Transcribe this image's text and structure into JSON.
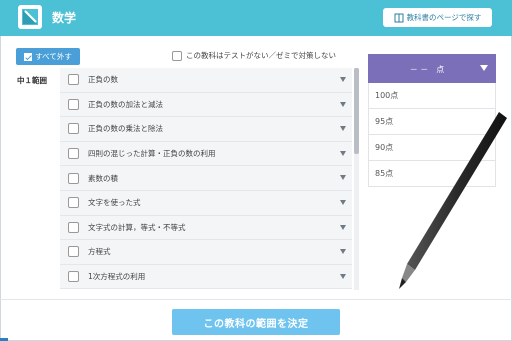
{
  "header": {
    "title": "数学",
    "textbook_button": "教科書のページで探す"
  },
  "controls": {
    "remove_all": "すべて外す",
    "no_test_option": "この教科はテストがない／ゼミで対策しない"
  },
  "range_label": "中１範囲",
  "topics": [
    "正負の数",
    "正負の数の加法と減法",
    "正負の数の乗法と除法",
    "四則の混じった計算・正負の数の利用",
    "素数の積",
    "文字を使った式",
    "文字式の計算，等式・不等式",
    "方程式",
    "1次方程式の利用"
  ],
  "score": {
    "selected": "－ －　点",
    "options": [
      "100点",
      "95点",
      "90点",
      "85点"
    ]
  },
  "decide_button": "この教科の範囲を決定",
  "colors": {
    "header": "#4cc0d4",
    "remove_all": "#4a9fd8",
    "score_head": "#7c6fba",
    "decide": "#6ec3ef"
  }
}
